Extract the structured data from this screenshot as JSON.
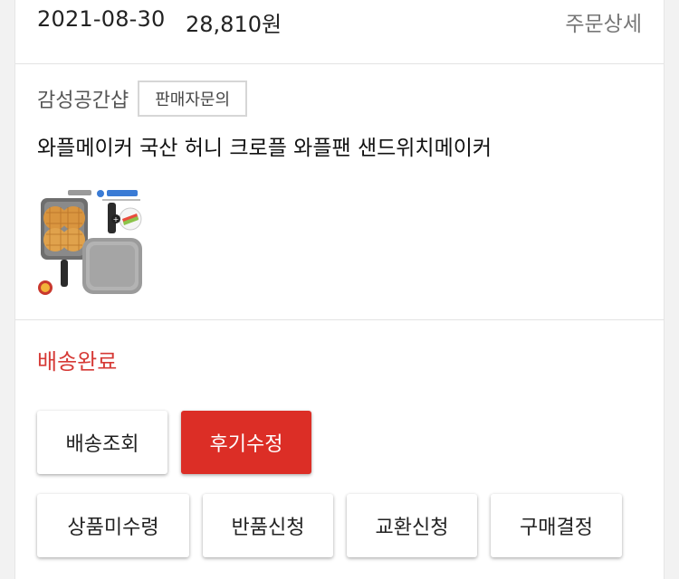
{
  "order": {
    "date": "2021-08-30",
    "price": "28,810원",
    "detail_link": "주문상세"
  },
  "shop": {
    "name": "감성공간샵",
    "inquiry_button": "판매자문의"
  },
  "product": {
    "name": "와플메이커 국산 허니 크로플 와플팬 샌드위치메이커",
    "thumbnail_icon": "waffle-maker-product-image"
  },
  "delivery": {
    "status": "배송완료",
    "status_color": "#d63a36"
  },
  "actions": {
    "track_delivery": "배송조회",
    "edit_review": "후기수정",
    "not_received": "상품미수령",
    "return_request": "반품신청",
    "exchange_request": "교환신청",
    "confirm_purchase": "구매결정"
  },
  "colors": {
    "accent": "#dc2e26",
    "text_muted": "#777777",
    "border": "#d6d6d6"
  }
}
